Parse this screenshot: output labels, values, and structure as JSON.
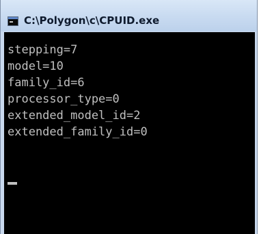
{
  "window": {
    "title": "C:\\Polygon\\c\\CPUID.exe",
    "icon": "console-window-icon"
  },
  "console": {
    "lines": [
      "stepping=7",
      "model=10",
      "family_id=6",
      "processor_type=0",
      "extended_model_id=2",
      "extended_family_id=0"
    ]
  },
  "colors": {
    "console_background": "#000000",
    "console_text": "#c0c0c0",
    "titlebar": "#c9dbf1"
  }
}
